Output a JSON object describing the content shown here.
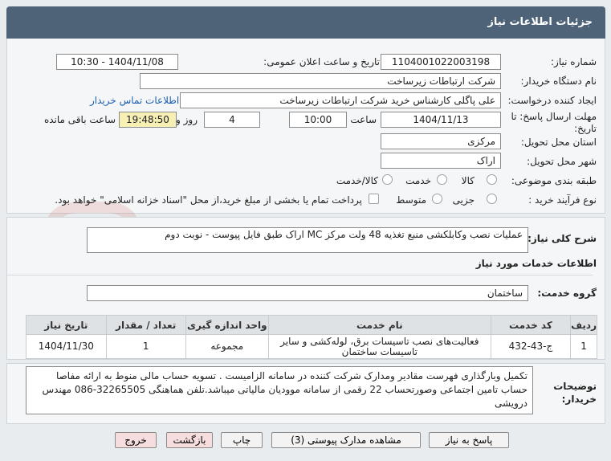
{
  "header": {
    "title": "جزئیات اطلاعات نیاز"
  },
  "fields": {
    "need_number_label": "شماره نیاز:",
    "need_number": "1104001022003198",
    "announce_label": "تاریخ و ساعت اعلان عمومی:",
    "announce_value": "1404/11/08 - 10:30",
    "buyer_label": "نام دستگاه خریدار:",
    "buyer": "شرکت ارتباطات زیرساخت",
    "creator_label": "ایجاد کننده درخواست:",
    "creator": "علی پاگلی کارشناس خرید شرکت ارتباطات زیرساخت",
    "contact_link": "اطلاعات تماس خریدار",
    "deadline_label_1": "مهلت ارسال پاسخ: تا",
    "deadline_label_2": "تاریخ:",
    "deadline_date": "1404/11/13",
    "time_label": "ساعت",
    "deadline_time": "10:00",
    "days_value": "4",
    "days_label": "روز و",
    "remaining_time": "19:48:50",
    "remaining_label": "ساعت باقی مانده",
    "province_label": "استان محل تحویل:",
    "province": "مرکزی",
    "city_label": "شهر محل تحویل:",
    "city": "اراک",
    "category_label": "طبقه بندی موضوعی:",
    "category_options": [
      "کالا",
      "خدمت",
      "کالا/خدمت"
    ],
    "process_label": "نوع فرآیند خرید :",
    "process_options": [
      "جزیی",
      "متوسط"
    ],
    "payment_note": "پرداخت تمام یا بخشی از مبلغ خرید،از محل \"اسناد خزانه اسلامی\" خواهد بود."
  },
  "summary": {
    "label": "شرح کلی نیاز:",
    "value": "عملیات نصب وکابلکشی منبع تغذیه 48 ولت مرکز MC اراک طبق فایل پیوست - نوبت دوم"
  },
  "services": {
    "section_title": "اطلاعات خدمات مورد نیاز",
    "group_label": "گروه خدمت:",
    "group_value": "ساختمان",
    "columns": [
      "ردیف",
      "کد خدمت",
      "نام خدمت",
      "واحد اندازه گیری",
      "تعداد / مقدار",
      "تاریخ نیاز"
    ],
    "rows": [
      [
        "1",
        "ج-43-432",
        "فعالیت‌های نصب تاسیسات برق، لوله‌کشی و سایر تاسیسات ساختمان",
        "مجموعه",
        "1",
        "1404/11/30"
      ]
    ]
  },
  "notes": {
    "label_1": "توضیحات",
    "label_2": "خریدار:",
    "text": "تکمیل وبارگذاری فهرست مقادیر ومدارک شرکت کننده در سامانه الزامیست . تسویه حساب مالی منوط به ارائه مفاصا حساب تامین اجتماعی وصورتحساب 22 رقمی از سامانه موودیان مالیاتی میباشد.تلفن هماهنگی 32265505-086 مهندس درویشی"
  },
  "buttons": {
    "reply": "پاسخ به نیاز",
    "docs": "مشاهده مدارک پیوستی (3)",
    "print": "چاپ",
    "back": "بازگشت",
    "exit": "خروج"
  },
  "watermark_text": "AriaTender.net"
}
